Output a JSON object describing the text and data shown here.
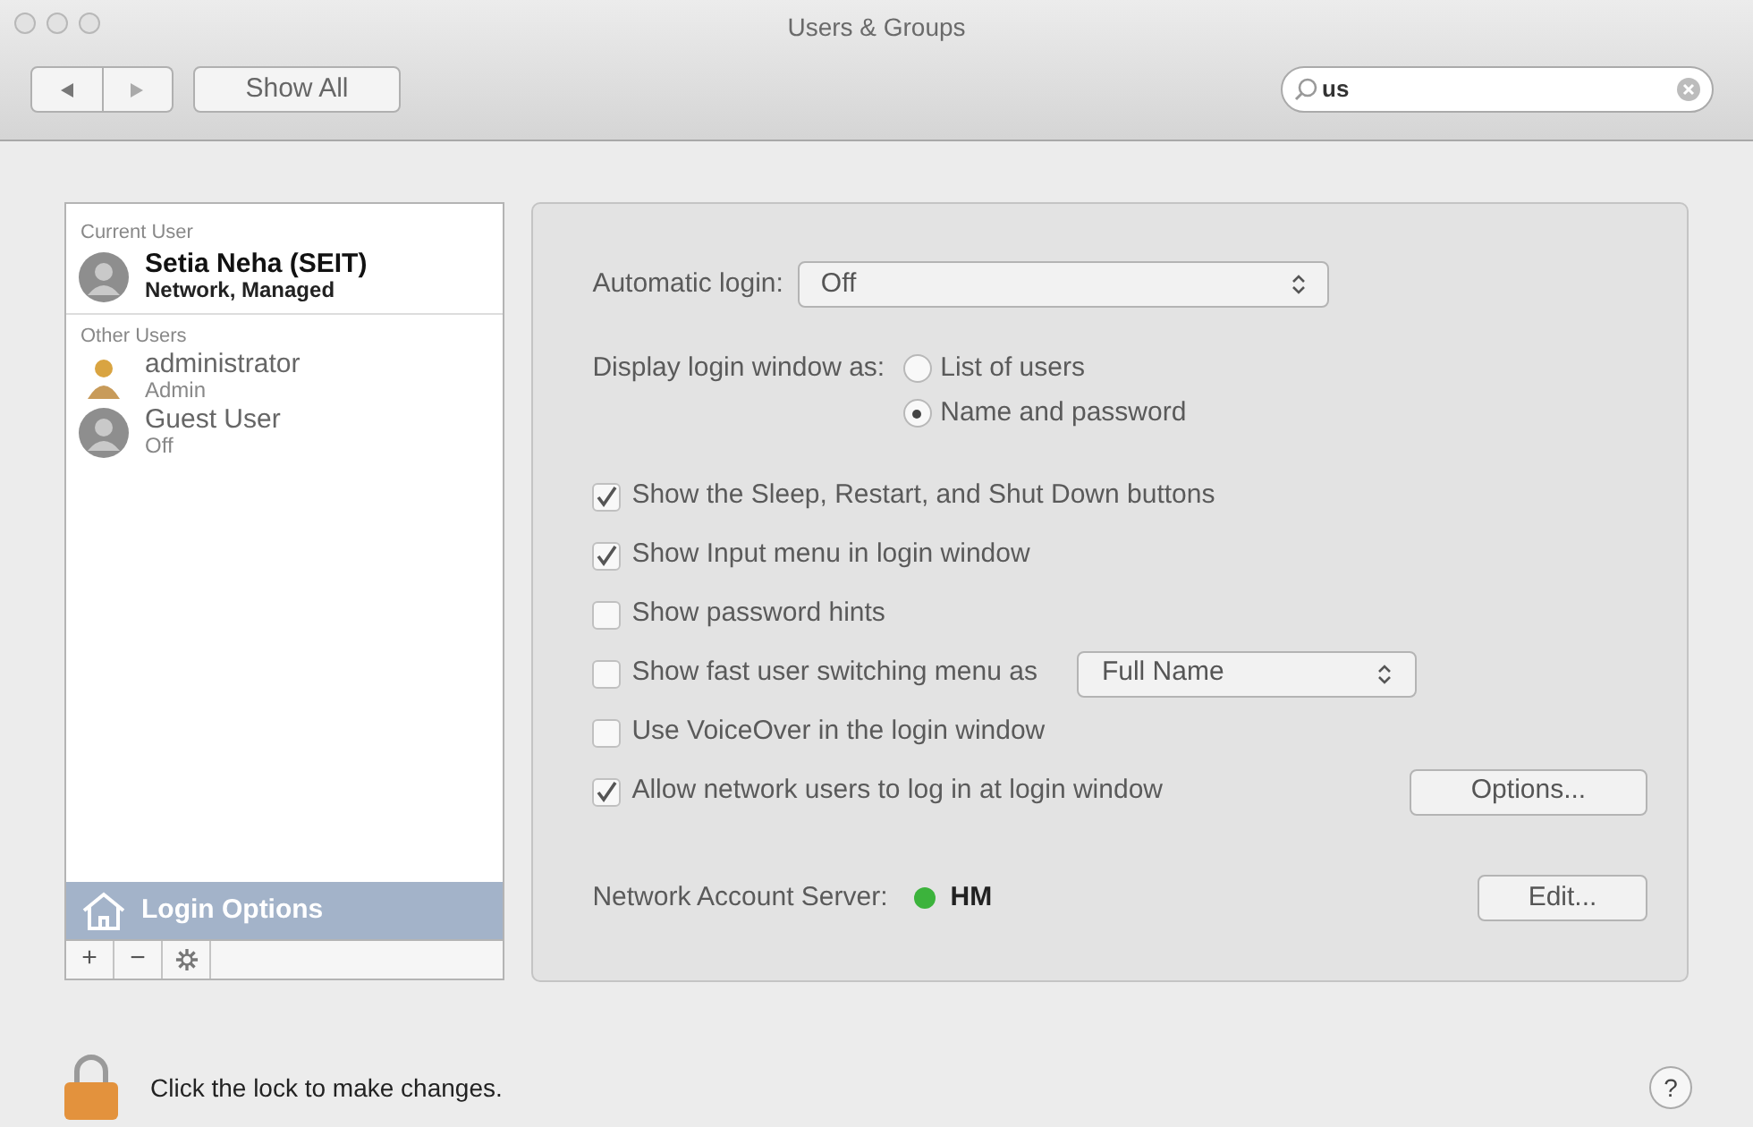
{
  "window": {
    "title": "Users & Groups"
  },
  "toolbar": {
    "show_all": "Show All",
    "search": {
      "value": "us"
    }
  },
  "sidebar": {
    "sections": [
      {
        "heading": "Current User",
        "users": [
          {
            "name": "Setia Neha (SEIT)",
            "detail": "Network, Managed",
            "kind": "person",
            "emphasis": true
          }
        ]
      },
      {
        "heading": "Other Users",
        "users": [
          {
            "name": "administrator",
            "detail": "Admin",
            "kind": "admin",
            "emphasis": false
          },
          {
            "name": "Guest User",
            "detail": "Off",
            "kind": "person",
            "emphasis": false
          }
        ]
      }
    ],
    "login_options": {
      "label": "Login Options",
      "selected": true
    },
    "buttons": [
      {
        "kind": "text",
        "label": "+"
      },
      {
        "kind": "text",
        "label": "−"
      },
      {
        "kind": "gear"
      }
    ]
  },
  "panel": {
    "automatic_login": {
      "label": "Automatic login:",
      "value": "Off"
    },
    "display_as": {
      "label": "Display login window as:",
      "options": [
        {
          "label": "List of users",
          "selected": false
        },
        {
          "label": "Name and password",
          "selected": true
        }
      ]
    },
    "checkboxes": [
      {
        "kind": "plain",
        "label": "Show the Sleep, Restart, and Shut Down buttons",
        "checked": true
      },
      {
        "kind": "plain",
        "label": "Show Input menu in login window",
        "checked": true
      },
      {
        "kind": "plain",
        "label": "Show password hints",
        "checked": false
      },
      {
        "kind": "popup",
        "label": "Show fast user switching menu as",
        "checked": false,
        "control": "Full Name"
      },
      {
        "kind": "plain",
        "label": "Use VoiceOver in the login window",
        "checked": false
      },
      {
        "kind": "button",
        "label": "Allow network users to log in at login window",
        "checked": true,
        "control": "Options..."
      }
    ],
    "network_server": {
      "label": "Network Account Server:",
      "color": "#3cb33c",
      "value": "HM",
      "button": "Edit..."
    }
  },
  "footer": {
    "text": "Click the lock to make changes.",
    "help": "?"
  }
}
